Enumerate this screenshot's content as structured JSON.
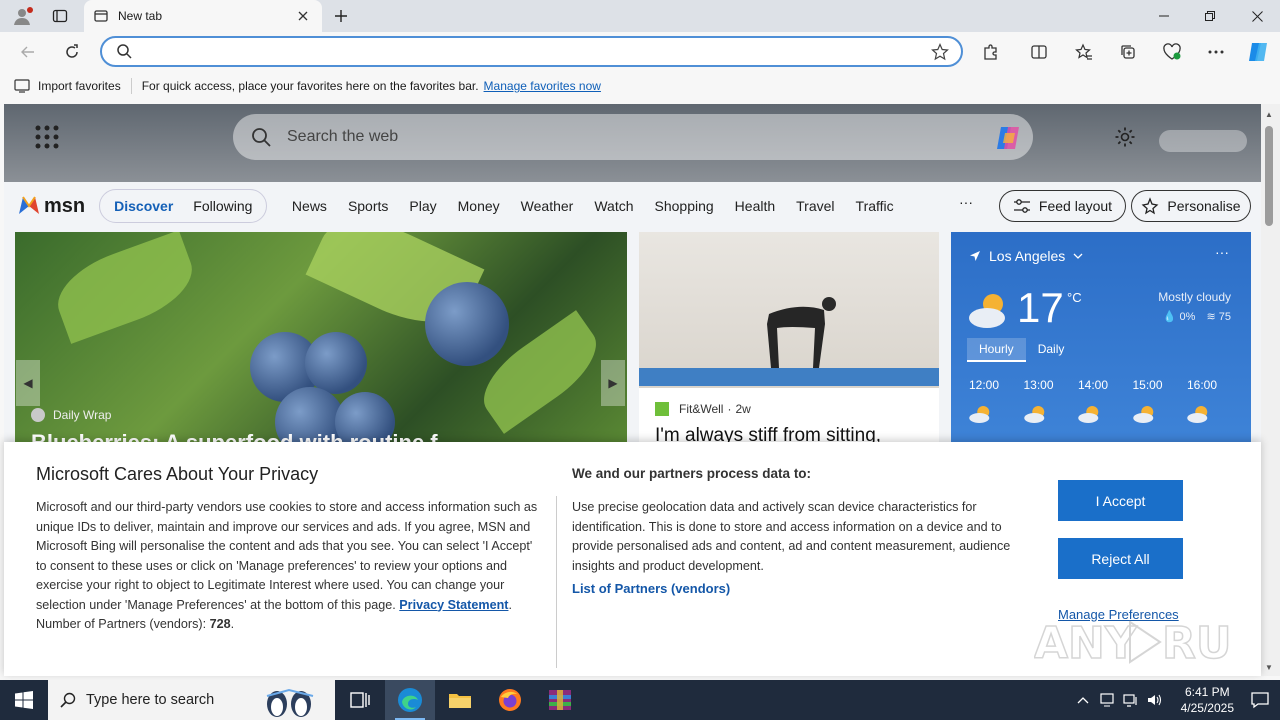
{
  "browser": {
    "tab_title": "New tab",
    "address_value": "",
    "favorites_bar": {
      "import_label": "Import favorites",
      "message": "For quick access, place your favorites here on the favorites bar.",
      "manage_link": "Manage favorites now"
    }
  },
  "msn": {
    "search_placeholder": "Search the web",
    "logo_text": "msn",
    "pill_tabs": [
      "Discover",
      "Following"
    ],
    "nav_links": [
      "News",
      "Sports",
      "Play",
      "Money",
      "Weather",
      "Watch",
      "Shopping",
      "Health",
      "Travel",
      "Traffic"
    ],
    "more": "···",
    "feed_layout": "Feed layout",
    "personalise": "Personalise",
    "card1": {
      "source": "Daily Wrap",
      "headline": "Blueberries: A superfood with routine f"
    },
    "card2": {
      "source": "Fit&Well",
      "age": "2w",
      "headline": "I'm always stiff from sitting,"
    },
    "weather": {
      "location": "Los Angeles",
      "temp": "17",
      "unit": "°C",
      "condition": "Mostly cloudy",
      "precip": "0%",
      "humidity": "75",
      "tabs": [
        "Hourly",
        "Daily"
      ],
      "hours": [
        "12:00",
        "13:00",
        "14:00",
        "15:00",
        "16:00"
      ]
    }
  },
  "consent": {
    "title": "Microsoft Cares About Your Privacy",
    "body": "Microsoft and our third-party vendors use cookies to store and access information such as unique IDs to deliver, maintain and improve our services and ads. If you agree, MSN and Microsoft Bing will personalise the content and ads that you see. You can select 'I Accept' to consent to these uses or click on 'Manage preferences' to review your options and exercise your right to object to Legitimate Interest where used.  You can change your selection under 'Manage Preferences' at the bottom of this page.",
    "privacy_link": "Privacy Statement",
    "partners_label": "Number of Partners (vendors):",
    "partners_count": "728",
    "process_title": "We and our partners process data to:",
    "process_text": "Use precise geolocation data and actively scan device characteristics for identification. This is done to store and access information on a device and to provide personalised ads and content, ad and content measurement, audience insights and product development.",
    "partners_list_link": "List of Partners (vendors)",
    "accept": "I Accept",
    "reject": "Reject All",
    "manage": "Manage Preferences"
  },
  "taskbar": {
    "search_placeholder": "Type here to search",
    "time": "6:41 PM",
    "date": "4/25/2025"
  }
}
